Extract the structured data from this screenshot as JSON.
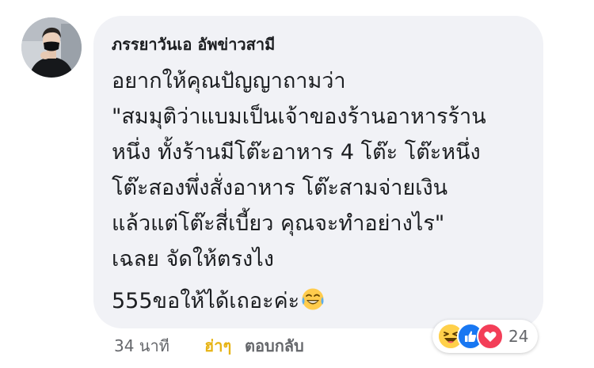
{
  "comment": {
    "author": "ภรรยาวันเอ อัพข่าวสามี",
    "lines": [
      "อยากให้คุณปัญญาถามว่า",
      "\"สมมุติว่าแบมเป็นเจ้าของร้านอาหารร้าน",
      "หนึ่ง ทั้งร้านมีโต๊ะอาหาร 4 โต๊ะ โต๊ะหนึ่ง",
      "โต๊ะสองพึ่งสั่งอาหาร โต๊ะสามจ่ายเงิน",
      "แล้วแต่โต๊ะสี่เบี้ยว คุณจะทำอย่างไร\"",
      "เฉลย จัดให้ตรงไง"
    ],
    "last_line": "555ขอให้ได้เถอะค่ะ",
    "last_line_emoji": "face-with-tears-of-joy-icon"
  },
  "actions": {
    "time": "34 นาที",
    "reaction_label": "ฮ่าๆ",
    "reply_label": "ตอบกลับ"
  },
  "reactions": {
    "icons": [
      "haha-icon",
      "like-icon",
      "love-icon"
    ],
    "count": "24"
  },
  "colors": {
    "bubble_bg": "#f1f2f6",
    "haha_accent": "#e7b416",
    "like_blue": "#1877f2",
    "love_red": "#f33e58",
    "muted_text": "#65676b"
  }
}
